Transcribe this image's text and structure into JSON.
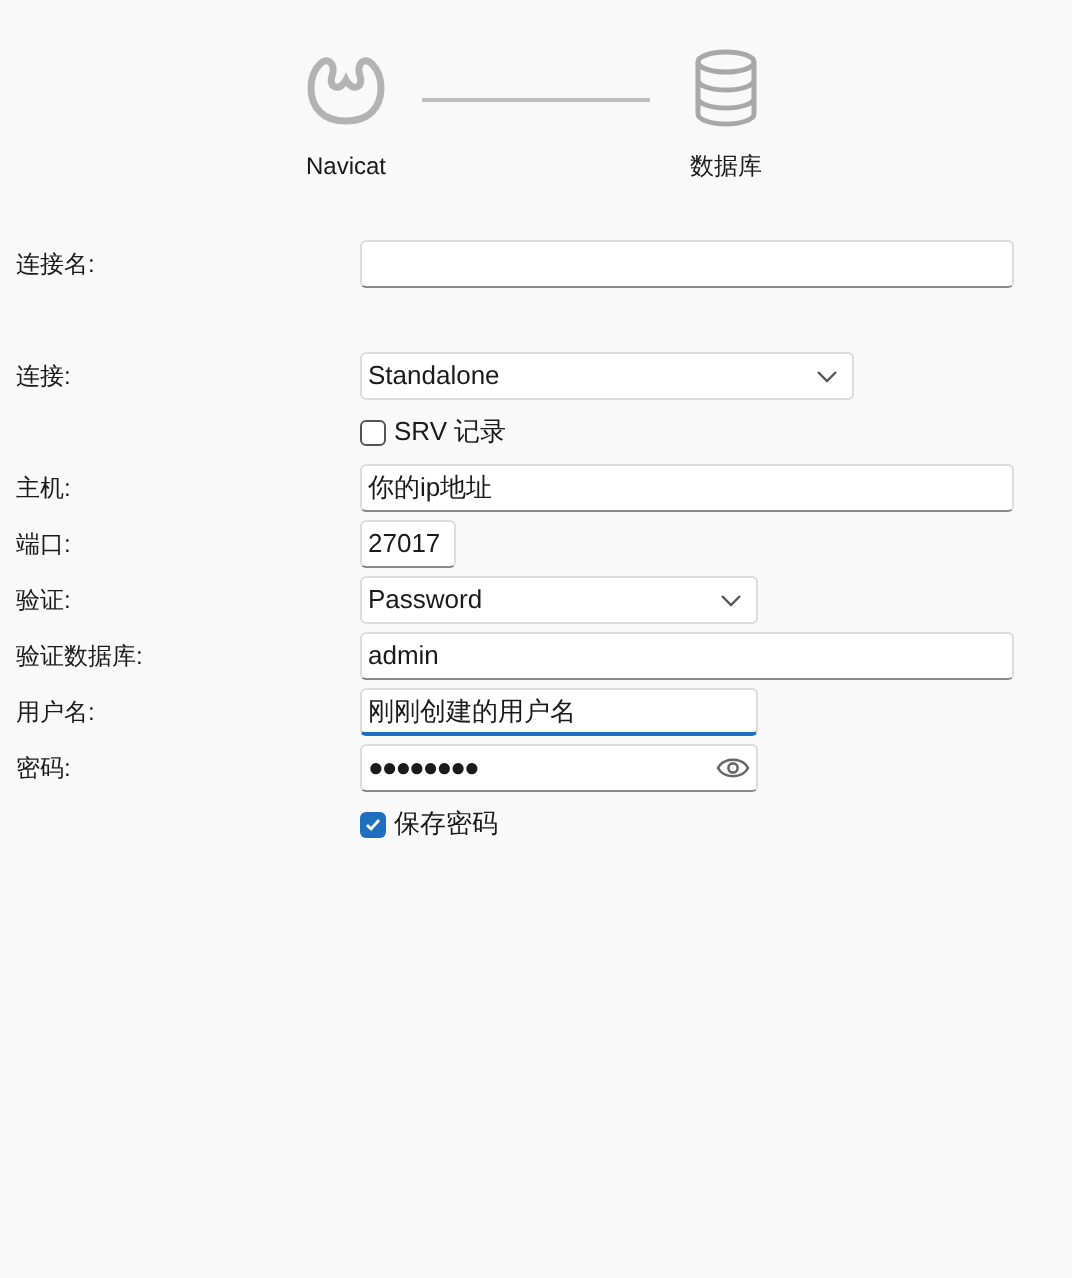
{
  "steps": [
    {
      "label": "Navicat",
      "kind": "navicat"
    },
    {
      "label": "数据库",
      "kind": "database"
    }
  ],
  "fields": [
    {
      "kind": "input",
      "label": "连接名:",
      "focused": false
    },
    {
      "kind": "select",
      "label": "连接:",
      "value": "Standalone"
    },
    {
      "kind": "checkbox",
      "text": "SRV 记录",
      "checked": false
    },
    {
      "kind": "input",
      "label": "主机:",
      "value": "你的ip地址",
      "focused": false
    },
    {
      "kind": "input",
      "label": "端口:",
      "value": "27017",
      "focused": false
    },
    {
      "kind": "select",
      "label": "验证:",
      "value": "Password"
    },
    {
      "kind": "input",
      "label": "验证数据库:",
      "value": "admin",
      "focused": false
    },
    {
      "kind": "input",
      "label": "用户名:",
      "value": "刚刚创建的用户名",
      "focused": true
    },
    {
      "kind": "password",
      "label": "密码:",
      "value": "●●●●●●●●"
    },
    {
      "kind": "checkbox",
      "text": "保存密码",
      "checked": true
    }
  ]
}
